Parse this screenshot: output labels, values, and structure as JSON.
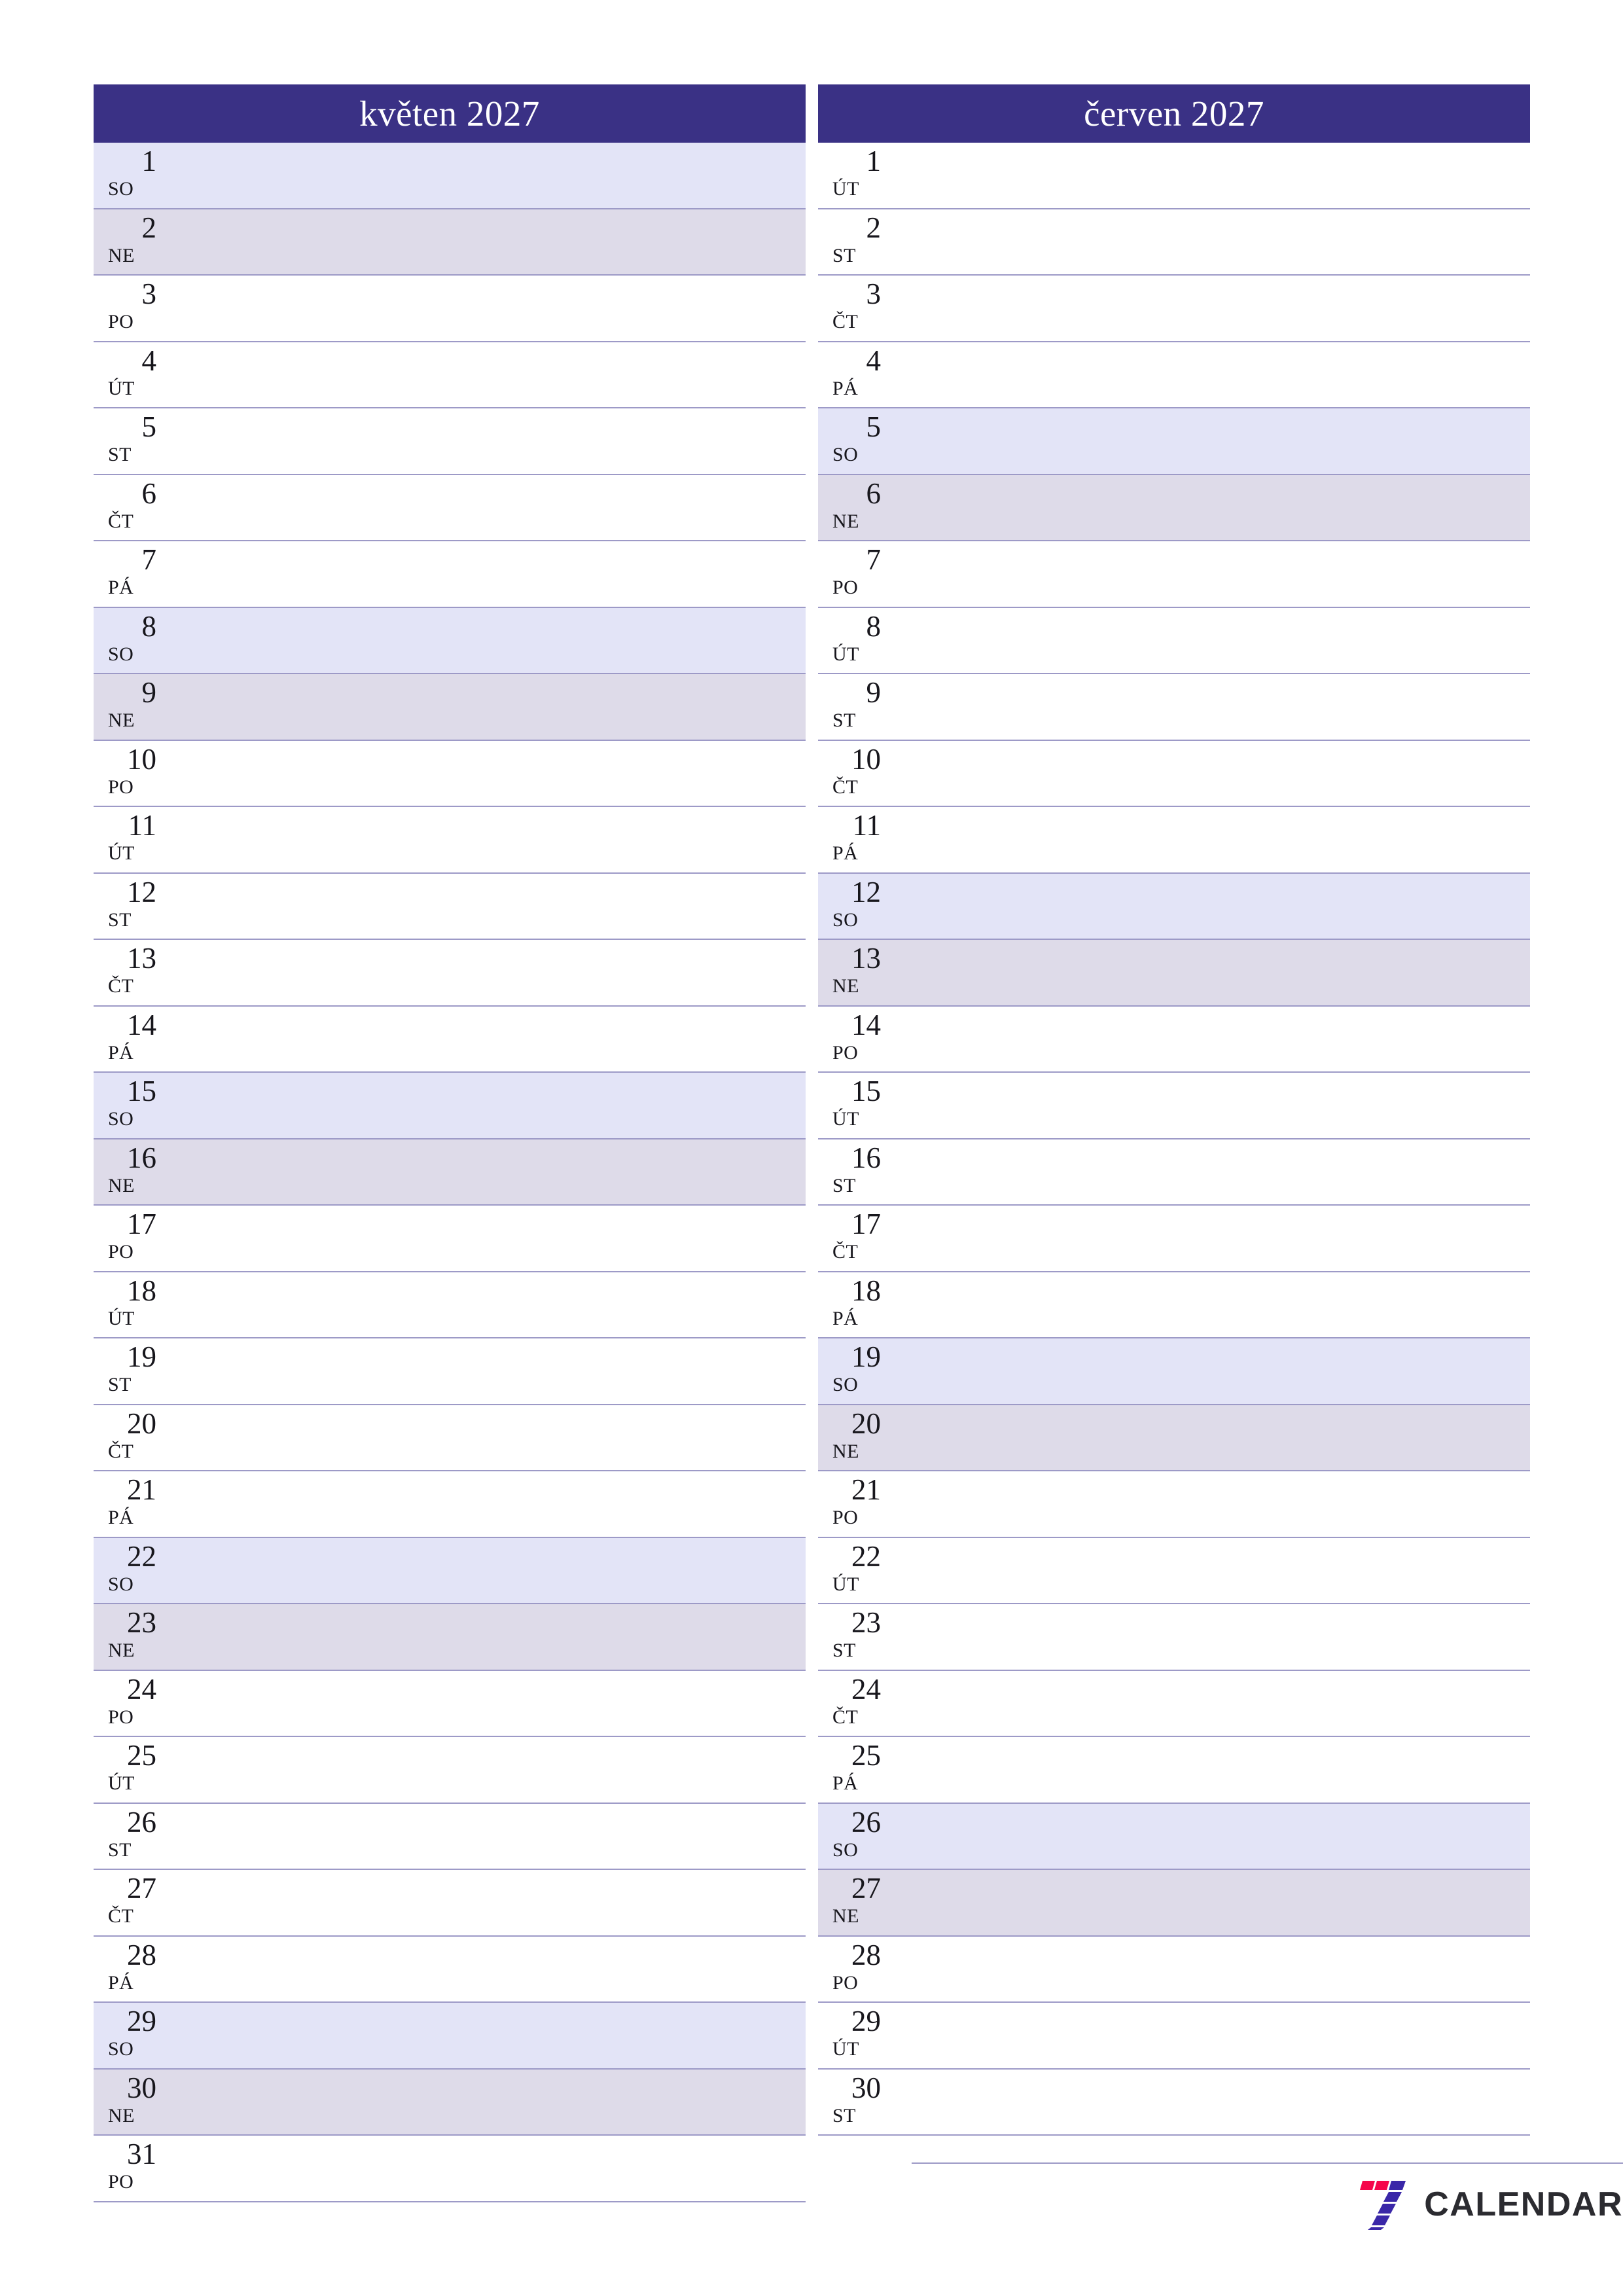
{
  "document": {
    "type": "monthly-planner",
    "language": "cs",
    "orientation": "portrait"
  },
  "colors": {
    "header_background": "#3a3185",
    "header_text": "#ffffff",
    "saturday_row": "#e3e4f7",
    "sunday_row": "#dedbe9",
    "row_divider": "#9d9ac7",
    "day_text": "#17161c",
    "logo_red": "#f5054b",
    "logo_purple": "#3a27a8",
    "brand_text": "#2b2b30"
  },
  "months": [
    {
      "title": "květen 2027",
      "days": [
        {
          "num": "1",
          "abbr": "SO",
          "type": "sat"
        },
        {
          "num": "2",
          "abbr": "NE",
          "type": "sun"
        },
        {
          "num": "3",
          "abbr": "PO",
          "type": "weekday"
        },
        {
          "num": "4",
          "abbr": "ÚT",
          "type": "weekday"
        },
        {
          "num": "5",
          "abbr": "ST",
          "type": "weekday"
        },
        {
          "num": "6",
          "abbr": "ČT",
          "type": "weekday"
        },
        {
          "num": "7",
          "abbr": "PÁ",
          "type": "weekday"
        },
        {
          "num": "8",
          "abbr": "SO",
          "type": "sat"
        },
        {
          "num": "9",
          "abbr": "NE",
          "type": "sun"
        },
        {
          "num": "10",
          "abbr": "PO",
          "type": "weekday"
        },
        {
          "num": "11",
          "abbr": "ÚT",
          "type": "weekday"
        },
        {
          "num": "12",
          "abbr": "ST",
          "type": "weekday"
        },
        {
          "num": "13",
          "abbr": "ČT",
          "type": "weekday"
        },
        {
          "num": "14",
          "abbr": "PÁ",
          "type": "weekday"
        },
        {
          "num": "15",
          "abbr": "SO",
          "type": "sat"
        },
        {
          "num": "16",
          "abbr": "NE",
          "type": "sun"
        },
        {
          "num": "17",
          "abbr": "PO",
          "type": "weekday"
        },
        {
          "num": "18",
          "abbr": "ÚT",
          "type": "weekday"
        },
        {
          "num": "19",
          "abbr": "ST",
          "type": "weekday"
        },
        {
          "num": "20",
          "abbr": "ČT",
          "type": "weekday"
        },
        {
          "num": "21",
          "abbr": "PÁ",
          "type": "weekday"
        },
        {
          "num": "22",
          "abbr": "SO",
          "type": "sat"
        },
        {
          "num": "23",
          "abbr": "NE",
          "type": "sun"
        },
        {
          "num": "24",
          "abbr": "PO",
          "type": "weekday"
        },
        {
          "num": "25",
          "abbr": "ÚT",
          "type": "weekday"
        },
        {
          "num": "26",
          "abbr": "ST",
          "type": "weekday"
        },
        {
          "num": "27",
          "abbr": "ČT",
          "type": "weekday"
        },
        {
          "num": "28",
          "abbr": "PÁ",
          "type": "weekday"
        },
        {
          "num": "29",
          "abbr": "SO",
          "type": "sat"
        },
        {
          "num": "30",
          "abbr": "NE",
          "type": "sun"
        },
        {
          "num": "31",
          "abbr": "PO",
          "type": "weekday"
        }
      ]
    },
    {
      "title": "červen 2027",
      "days": [
        {
          "num": "1",
          "abbr": "ÚT",
          "type": "weekday"
        },
        {
          "num": "2",
          "abbr": "ST",
          "type": "weekday"
        },
        {
          "num": "3",
          "abbr": "ČT",
          "type": "weekday"
        },
        {
          "num": "4",
          "abbr": "PÁ",
          "type": "weekday"
        },
        {
          "num": "5",
          "abbr": "SO",
          "type": "sat"
        },
        {
          "num": "6",
          "abbr": "NE",
          "type": "sun"
        },
        {
          "num": "7",
          "abbr": "PO",
          "type": "weekday"
        },
        {
          "num": "8",
          "abbr": "ÚT",
          "type": "weekday"
        },
        {
          "num": "9",
          "abbr": "ST",
          "type": "weekday"
        },
        {
          "num": "10",
          "abbr": "ČT",
          "type": "weekday"
        },
        {
          "num": "11",
          "abbr": "PÁ",
          "type": "weekday"
        },
        {
          "num": "12",
          "abbr": "SO",
          "type": "sat"
        },
        {
          "num": "13",
          "abbr": "NE",
          "type": "sun"
        },
        {
          "num": "14",
          "abbr": "PO",
          "type": "weekday"
        },
        {
          "num": "15",
          "abbr": "ÚT",
          "type": "weekday"
        },
        {
          "num": "16",
          "abbr": "ST",
          "type": "weekday"
        },
        {
          "num": "17",
          "abbr": "ČT",
          "type": "weekday"
        },
        {
          "num": "18",
          "abbr": "PÁ",
          "type": "weekday"
        },
        {
          "num": "19",
          "abbr": "SO",
          "type": "sat"
        },
        {
          "num": "20",
          "abbr": "NE",
          "type": "sun"
        },
        {
          "num": "21",
          "abbr": "PO",
          "type": "weekday"
        },
        {
          "num": "22",
          "abbr": "ÚT",
          "type": "weekday"
        },
        {
          "num": "23",
          "abbr": "ST",
          "type": "weekday"
        },
        {
          "num": "24",
          "abbr": "ČT",
          "type": "weekday"
        },
        {
          "num": "25",
          "abbr": "PÁ",
          "type": "weekday"
        },
        {
          "num": "26",
          "abbr": "SO",
          "type": "sat"
        },
        {
          "num": "27",
          "abbr": "NE",
          "type": "sun"
        },
        {
          "num": "28",
          "abbr": "PO",
          "type": "weekday"
        },
        {
          "num": "29",
          "abbr": "ÚT",
          "type": "weekday"
        },
        {
          "num": "30",
          "abbr": "ST",
          "type": "weekday"
        }
      ]
    }
  ],
  "footer": {
    "brand_name": "CALENDAR",
    "logo_icon": "seven-logo-icon"
  }
}
